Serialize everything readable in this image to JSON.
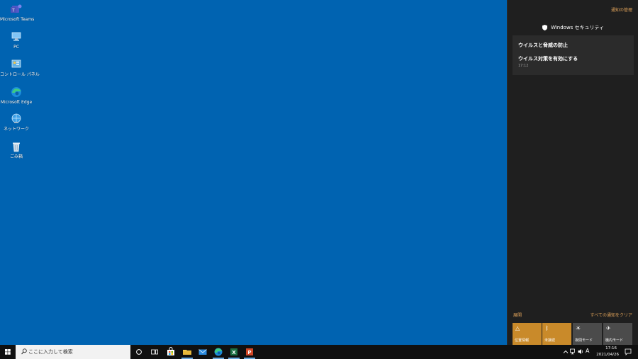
{
  "desktop": {
    "icons": [
      {
        "label": "Microsoft Teams",
        "icon": "teams-icon"
      },
      {
        "label": "PC",
        "icon": "pc-icon"
      },
      {
        "label": "コントロール パネル",
        "icon": "control-panel-icon"
      },
      {
        "label": "Microsoft Edge",
        "icon": "edge-icon"
      },
      {
        "label": "ネットワーク",
        "icon": "network-icon"
      },
      {
        "label": "ごみ箱",
        "icon": "recycle-bin-icon"
      }
    ]
  },
  "action_center": {
    "manage_label": "通知の管理",
    "app_name": "Windows セキュリティ",
    "notification": {
      "title": "ウイルスと脅威の防止",
      "body": "ウイルス対策を有効にする",
      "time": "17:12"
    },
    "expand_label": "展開",
    "clear_all_label": "すべての通知をクリア",
    "quick_actions": [
      {
        "label": "位置情報",
        "icon": "location-icon",
        "active": true
      },
      {
        "label": "未接続",
        "icon": "bluetooth-icon",
        "active": true
      },
      {
        "label": "夜間モード",
        "icon": "night-light-icon",
        "active": false
      },
      {
        "label": "機内モード",
        "icon": "airplane-mode-icon",
        "active": false
      }
    ]
  },
  "taskbar": {
    "search_placeholder": "ここに入力して検索",
    "clock_time": "17:16",
    "clock_date": "2021/04/26",
    "ime_label": "A",
    "pinned": [
      "cortana-icon",
      "task-view-icon",
      "store-icon",
      "file-explorer-icon",
      "mail-icon",
      "edge-icon",
      "excel-icon",
      "powerpoint-icon"
    ]
  },
  "colors": {
    "desktop_bg": "#0063b1",
    "action_center_bg": "#1f1f1f",
    "accent": "#e0a35a",
    "tile_active": "#c98a2a",
    "tile_inactive": "#4b4b4b"
  }
}
